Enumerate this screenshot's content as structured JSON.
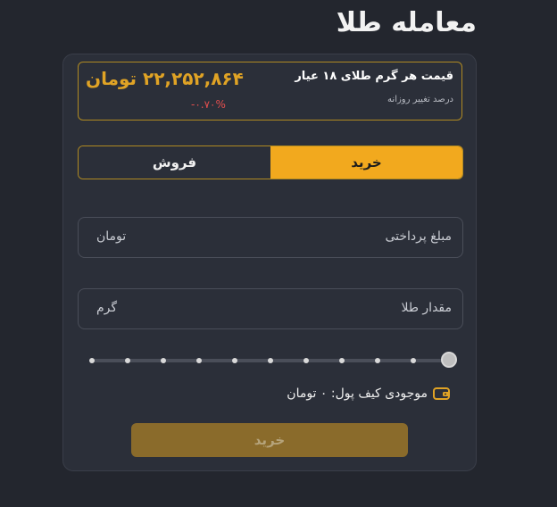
{
  "page": {
    "title": "معامله طلا"
  },
  "price_box": {
    "label": "قیمت هر گرم طلای ۱۸ عیار",
    "value": "۲۲,۲۵۲,۸۶۴ تومان",
    "change_label": "درصد تغییر روزانه",
    "change_value": "-۰.۷۰%"
  },
  "tabs": [
    {
      "label": "فروش",
      "active": false
    },
    {
      "label": "خرید",
      "active": true
    }
  ],
  "amount_field": {
    "label": "مبلغ پرداختی",
    "unit": "تومان",
    "value": ""
  },
  "gold_field": {
    "label": "مقدار طلا",
    "unit": "گرم",
    "value": ""
  },
  "slider": {
    "steps": 11,
    "value_percent": 100
  },
  "wallet": {
    "text": "موجودی کیف پول: ۰ تومان",
    "icon": "wallet-icon"
  },
  "submit": {
    "label": "خرید"
  },
  "colors": {
    "accent": "#f2a91e",
    "negative": "#e24e4e",
    "price": "#e0a325"
  }
}
